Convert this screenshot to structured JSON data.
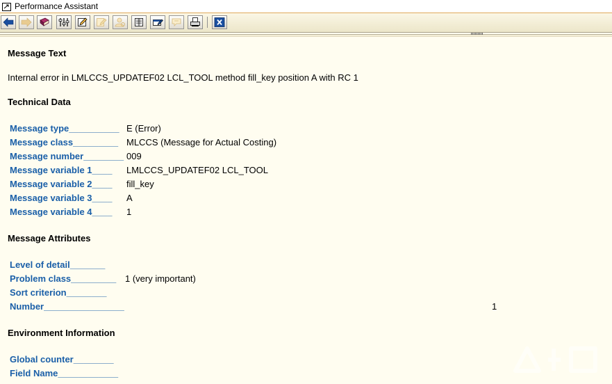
{
  "window": {
    "title": "Performance Assistant"
  },
  "toolbar": {
    "buttons": [
      {
        "icon": "back-arrow-icon",
        "enabled": true
      },
      {
        "icon": "forward-arrow-icon",
        "enabled": false
      },
      {
        "icon": "help-book-icon",
        "enabled": true
      },
      {
        "icon": "technical-info-icon",
        "enabled": true
      },
      {
        "icon": "edit-icon",
        "enabled": true
      },
      {
        "icon": "notepad-icon",
        "enabled": false
      },
      {
        "icon": "user-settings-icon",
        "enabled": false
      },
      {
        "icon": "glossary-icon",
        "enabled": true
      },
      {
        "icon": "release-notes-icon",
        "enabled": true
      },
      {
        "icon": "feedback-icon",
        "enabled": false
      },
      {
        "icon": "print-icon",
        "enabled": true
      },
      {
        "icon": "close-icon",
        "enabled": true
      }
    ]
  },
  "message": {
    "heading": "Message Text",
    "text": "Internal error in LMLCCS_UPDATEF02 LCL_TOOL method fill_key position A with RC 1"
  },
  "technical": {
    "heading": "Technical Data",
    "fields": [
      {
        "label": "Message type__________",
        "value": "E (Error)"
      },
      {
        "label": "Message class_________",
        "value": "MLCCS (Message for Actual Costing)"
      },
      {
        "label": "Message number________",
        "value": "009"
      },
      {
        "label": "Message variable 1____",
        "value": "LMLCCS_UPDATEF02 LCL_TOOL"
      },
      {
        "label": "Message variable 2____",
        "value": "fill_key"
      },
      {
        "label": "Message variable 3____",
        "value": "A"
      },
      {
        "label": "Message variable 4____",
        "value": "1"
      }
    ]
  },
  "attributes": {
    "heading": "Message Attributes",
    "fields": [
      {
        "label": "Level of detail_______",
        "value": ""
      },
      {
        "label": "Problem class_________",
        "value": "1 (very important)"
      },
      {
        "label": "Sort criterion________",
        "value": ""
      },
      {
        "label": "Number________________",
        "value": "1"
      }
    ]
  },
  "environment": {
    "heading": "Environment Information",
    "fields": [
      {
        "label": "Global counter________",
        "value": ""
      },
      {
        "label": "Field Name____________",
        "value": ""
      }
    ]
  },
  "colors": {
    "background": "#fffdf0",
    "label": "#1a5fa8",
    "title_border": "#e0a85a"
  }
}
